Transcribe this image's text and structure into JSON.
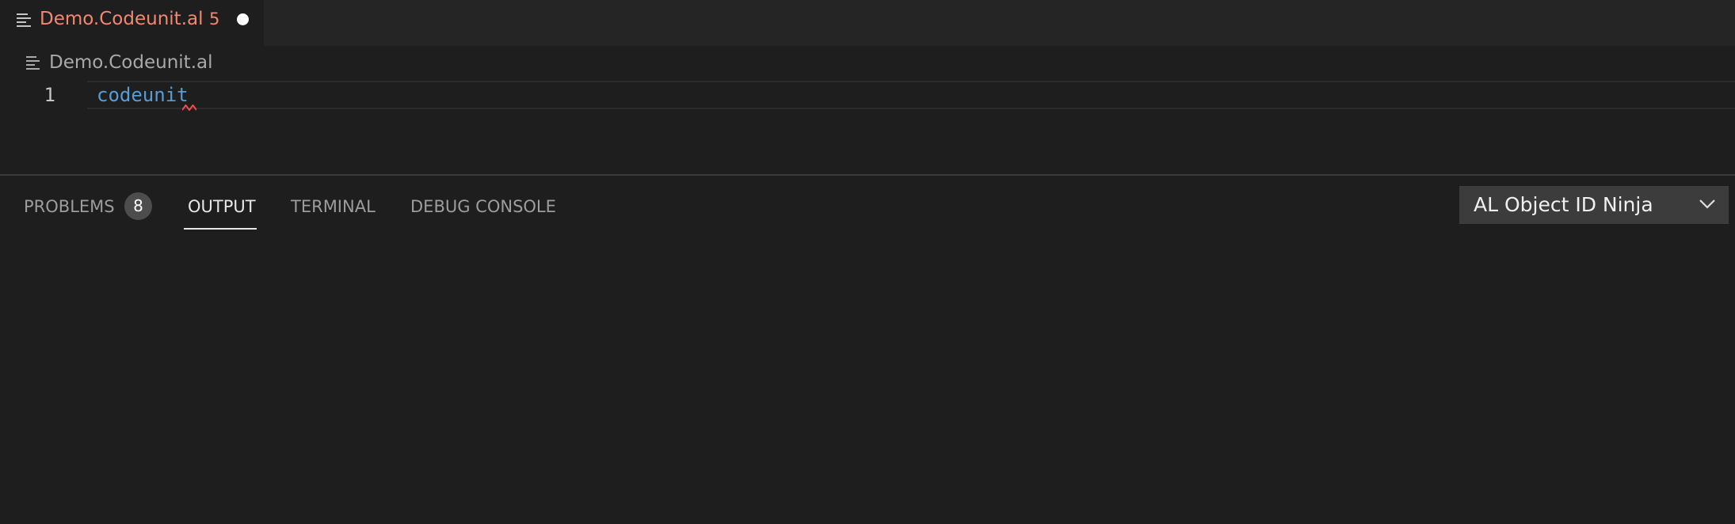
{
  "colors": {
    "editor_bg": "#1e1e1e",
    "tabbar_bg": "#252526",
    "error_text": "#f48771",
    "keyword": "#569cd6",
    "squiggle": "#f14c4c",
    "select_bg": "#3c3c3c"
  },
  "editor_tab": {
    "icon": "file-lines-icon",
    "label": "Demo.Codeunit.al",
    "problem_count": "5",
    "unsaved": true
  },
  "breadcrumb": {
    "icon": "file-lines-icon",
    "file": "Demo.Codeunit.al"
  },
  "editor": {
    "lines": [
      {
        "number": "1",
        "text": "codeunit"
      }
    ]
  },
  "panel": {
    "tabs": {
      "problems": "PROBLEMS",
      "problems_badge": "8",
      "output": "OUTPUT",
      "terminal": "TERMINAL",
      "debug_console": "DEBUG CONSOLE"
    },
    "active_tab": "OUTPUT",
    "output_channel": "AL Object ID Ninja",
    "output_channel_icon": "chevron-down-icon"
  }
}
